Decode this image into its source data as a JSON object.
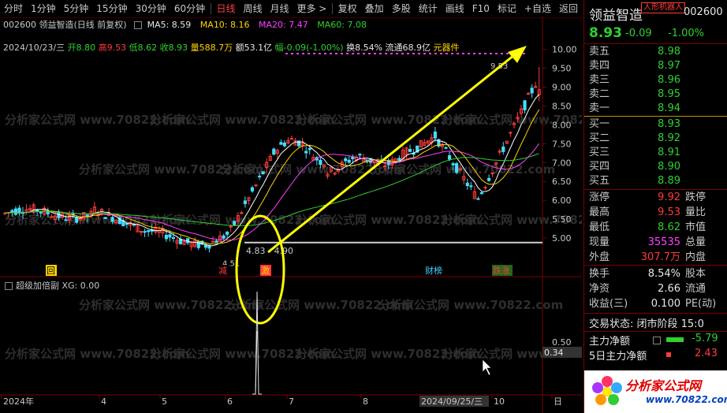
{
  "toolbar": {
    "items": [
      "分时",
      "1分钟",
      "5分钟",
      "15分钟",
      "30分钟",
      "60分钟",
      "日线",
      "周线",
      "月线",
      "更多 >",
      "复权",
      "叠加",
      "多股",
      "统计",
      "画线",
      "F10",
      "标记",
      "+自选",
      "返回"
    ],
    "active_index": 6
  },
  "header": {
    "stock": "002600 领益智造(日线 前复权)",
    "ma5": "MA5: 8.59",
    "ma10": "MA10: 8.16",
    "ma20": "MA20: 7.47",
    "ma60": "MA60: 7.08",
    "date": "2024/10/23/三",
    "open": "开8.80",
    "high": "高9.53",
    "low": "低8.62",
    "close": "收8.93",
    "volume": "量588.7万",
    "amount": "额53.1亿",
    "change": "幅-0.09(-1.00%)",
    "turnover": "换8.54%",
    "float": "流通68.9亿",
    "sector": "元器件"
  },
  "chart": {
    "y_ticks": [
      "10.00",
      "9.50",
      "9.00",
      "8.50",
      "8.00",
      "7.50",
      "7.00",
      "6.50",
      "6.00",
      "5.50",
      "5.00"
    ],
    "high_label": "9.53",
    "low_label": "4.51",
    "range_label": "4.83 - 4.90",
    "markers": {
      "hui": "回",
      "jian": "减",
      "ji": "激",
      "caibang": "财榜",
      "diezhang": "跌涨"
    }
  },
  "sub": {
    "title": "超级加倍副 XG: 0.00",
    "y_tick1": "0.50",
    "y_tick2": "0.34"
  },
  "x_axis": {
    "labels": [
      "2024年",
      "4",
      "5",
      "6",
      "7",
      "8",
      "2024/09/25/三",
      "10",
      "日"
    ]
  },
  "watermark": "分析家公式网 www.70822.com",
  "panel": {
    "name": "领益智造",
    "badge": "人形机器人",
    "code": "002600",
    "price": "8.93",
    "change": "-0.09",
    "pct": "-1.00%",
    "sells": [
      {
        "label": "卖五",
        "price": "8.98"
      },
      {
        "label": "卖四",
        "price": "8.97"
      },
      {
        "label": "卖三",
        "price": "8.96"
      },
      {
        "label": "卖二",
        "price": "8.95"
      },
      {
        "label": "卖一",
        "price": "8.94"
      }
    ],
    "buys": [
      {
        "label": "买一",
        "price": "8.93"
      },
      {
        "label": "买二",
        "price": "8.92"
      },
      {
        "label": "买三",
        "price": "8.91"
      },
      {
        "label": "买四",
        "price": "8.90"
      },
      {
        "label": "买五",
        "price": "8.89"
      }
    ],
    "stats": [
      {
        "l1": "涨停",
        "v1": "9.92",
        "c1": "up",
        "l2": "跌停"
      },
      {
        "l1": "最高",
        "v1": "9.53",
        "c1": "up",
        "l2": "量比"
      },
      {
        "l1": "最低",
        "v1": "8.62",
        "c1": "dn",
        "l2": "市值"
      },
      {
        "l1": "现量",
        "v1": "35535",
        "c1": "mg",
        "l2": "总量"
      },
      {
        "l1": "外盘",
        "v1": "307.7万",
        "c1": "up",
        "l2": "内盘"
      }
    ],
    "stats2": [
      {
        "l1": "换手",
        "v1": "8.54%",
        "c1": "wh",
        "l2": "股本"
      },
      {
        "l1": "净资",
        "v1": "2.66",
        "c1": "wh",
        "l2": "流通"
      },
      {
        "l1": "收益(三)",
        "v1": "0.100",
        "c1": "wh",
        "l2": "PE(动)"
      }
    ],
    "trade_state": "交易状态: 闭市阶段 15:0",
    "main_net_label": "主力净额",
    "main_net_value": "-5.79",
    "main5_label": "5日主力净额",
    "main5_value": "2.43",
    "logo_text": "分析家公式网",
    "logo_url": "www.70822.com"
  },
  "chart_data": {
    "type": "line",
    "description_series": [
      {
        "name": "MA5",
        "color": "#ffffff"
      },
      {
        "name": "MA10",
        "color": "#ffd400"
      },
      {
        "name": "MA20",
        "color": "#ff40ff"
      },
      {
        "name": "MA60",
        "color": "#2fd02f"
      }
    ],
    "ylim": [
      4.5,
      10.2
    ],
    "colors": {
      "up": "#ff3b3b",
      "down": "#40e0ff",
      "arrow": "#ffff00"
    }
  }
}
